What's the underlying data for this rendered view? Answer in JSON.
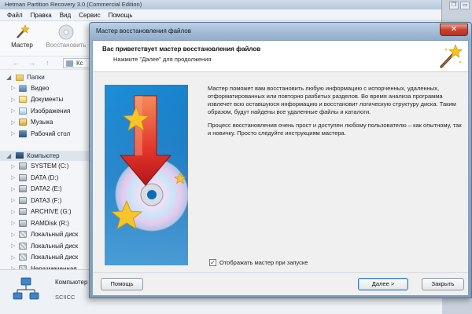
{
  "main_window": {
    "title": "Hetman Partition Recovery 3.0 (Commercial Edition)",
    "menu": [
      "Файл",
      "Правка",
      "Вид",
      "Сервис",
      "Помощь"
    ],
    "toolbar": {
      "wizard_label": "Мастер",
      "restore_label": "Восстановить"
    },
    "address_text": "Кс",
    "tree": {
      "folders_header": "Папки",
      "folders": [
        {
          "label": "Видео",
          "icon": "video-folder-icon"
        },
        {
          "label": "Документы",
          "icon": "documents-folder-icon"
        },
        {
          "label": "Изображения",
          "icon": "images-folder-icon"
        },
        {
          "label": "Музыка",
          "icon": "music-folder-icon"
        },
        {
          "label": "Рабочий стол",
          "icon": "desktop-folder-icon"
        }
      ],
      "computer_header": "Компьютер",
      "drives": [
        {
          "label": "SYSTEM (C:)",
          "icon": "drive-icon"
        },
        {
          "label": "DATA (D:)",
          "icon": "drive-icon"
        },
        {
          "label": "DATA2 (E:)",
          "icon": "drive-icon"
        },
        {
          "label": "DATA3 (F:)",
          "icon": "drive-icon"
        },
        {
          "label": "ARCHIVE (G:)",
          "icon": "drive-icon"
        },
        {
          "label": "RAMDisk (R:)",
          "icon": "drive-icon"
        },
        {
          "label": "Локальный диск",
          "icon": "unallocated-drive-icon"
        },
        {
          "label": "Локальный диск",
          "icon": "unallocated-drive-icon"
        },
        {
          "label": "Локальный диск",
          "icon": "unallocated-drive-icon"
        },
        {
          "label": "Неразмеченная",
          "icon": "unallocated-drive-icon"
        }
      ]
    },
    "status": {
      "name": "Компьютер",
      "sub": "SCIICC"
    }
  },
  "wizard": {
    "title": "Мастер восстановления файлов",
    "close_glyph": "✕",
    "header_title": "Вас приветствует мастер восстановления файлов",
    "header_subtitle": "Нажмите \"Далее\" для продолжения",
    "paragraph1": "Мастер поможет вам восстановить любую информацию с испорченных, удаленных, отформатированных или повторно разбитых разделов. Во время анализа программа извлечет всю оставшуюся информацию и восстановит логическую структуру диска. Таким образом, будут найдены все удаленные файлы и каталоги.",
    "paragraph2": "Процесс восстановления очень прост и доступен любому пользователю – как опытному, так и новичку. Просто следуйте инструкциям мастера.",
    "show_on_startup_label": "Отображать мастер при запуске",
    "show_on_startup_checked": true,
    "help_button": "Помощь",
    "next_button": "Далее >",
    "close_button": "Закрыть"
  },
  "colors": {
    "title_gradient": "#a2bbd6",
    "close_red": "#c7412f",
    "art_blue": "#0b6cb8"
  }
}
